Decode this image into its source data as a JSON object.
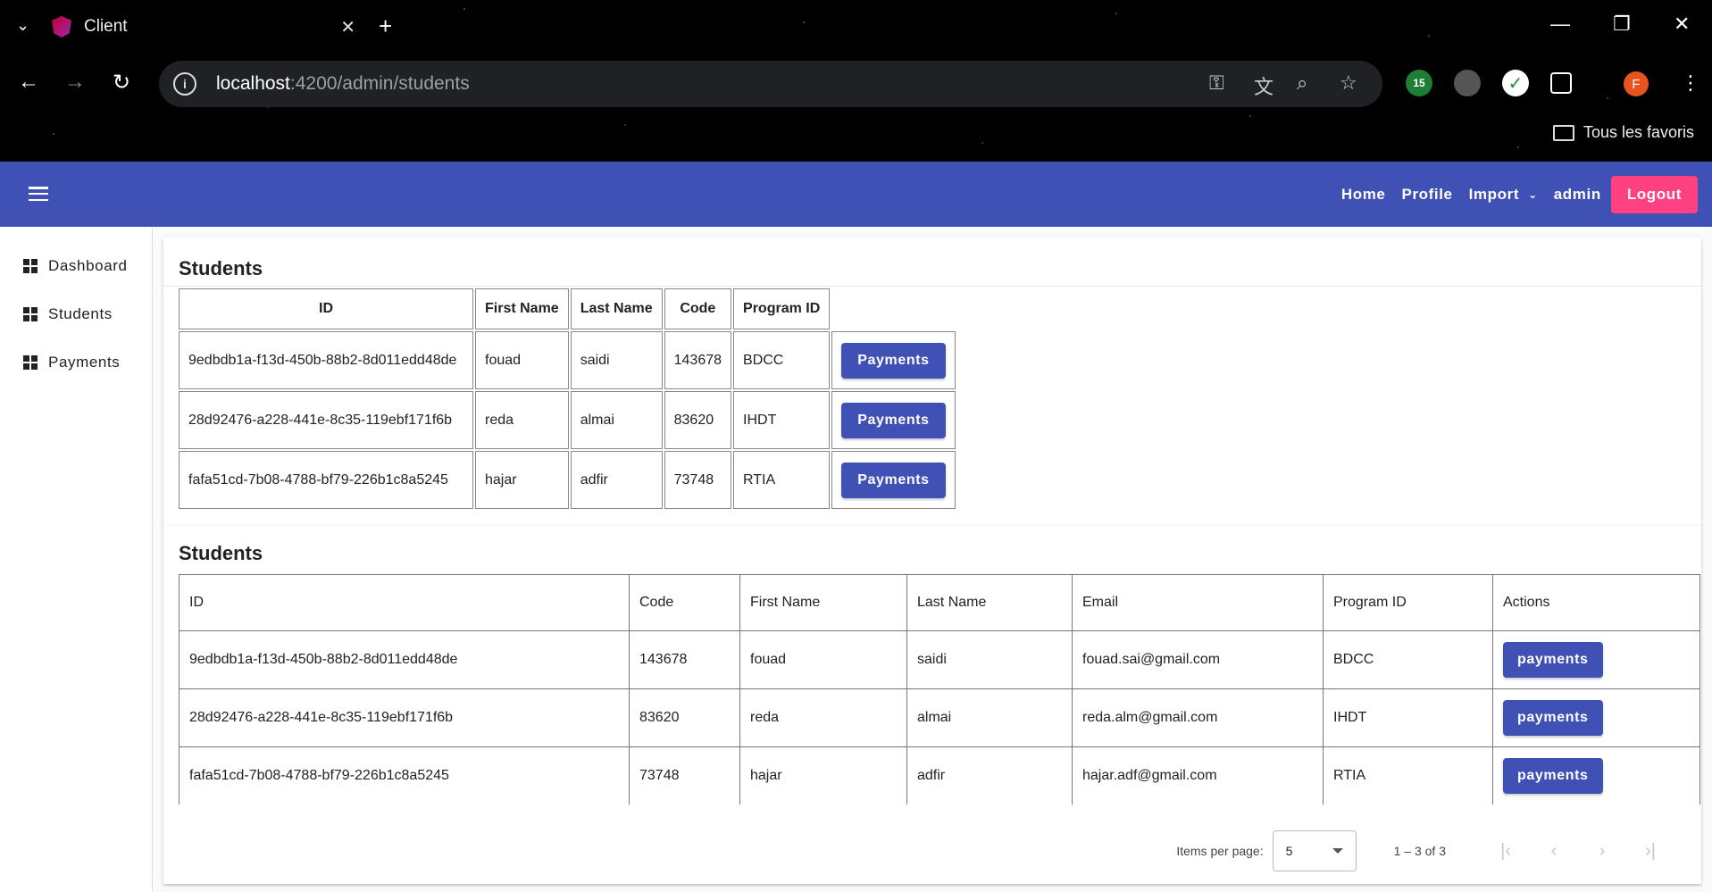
{
  "browser": {
    "tab_title": "Client",
    "url_host": "localhost",
    "url_rest": ":4200/admin/students",
    "bookmarks_label": "Tous les favoris",
    "profile_initial": "F",
    "extension_badge": "15"
  },
  "toolbar": {
    "home": "Home",
    "profile": "Profile",
    "import": "Import",
    "user": "admin",
    "logout": "Logout"
  },
  "sidebar": {
    "items": [
      {
        "label": "Dashboard"
      },
      {
        "label": "Students"
      },
      {
        "label": "Payments"
      }
    ]
  },
  "card1": {
    "title": "Students",
    "headers": [
      "ID",
      "First Name",
      "Last Name",
      "Code",
      "Program ID"
    ],
    "rows": [
      {
        "id": "9edbdb1a-f13d-450b-88b2-8d011edd48de",
        "first": "fouad",
        "last": "saidi",
        "code": "143678",
        "program": "BDCC",
        "action": "Payments"
      },
      {
        "id": "28d92476-a228-441e-8c35-119ebf171f6b",
        "first": "reda",
        "last": "almai",
        "code": "83620",
        "program": "IHDT",
        "action": "Payments"
      },
      {
        "id": "fafa51cd-7b08-4788-bf79-226b1c8a5245",
        "first": "hajar",
        "last": "adfir",
        "code": "73748",
        "program": "RTIA",
        "action": "Payments"
      }
    ]
  },
  "card2": {
    "title": "Students",
    "headers": [
      "ID",
      "Code",
      "First Name",
      "Last Name",
      "Email",
      "Program ID",
      "Actions"
    ],
    "rows": [
      {
        "id": "9edbdb1a-f13d-450b-88b2-8d011edd48de",
        "code": "143678",
        "first": "fouad",
        "last": "saidi",
        "email": "fouad.sai@gmail.com",
        "program": "BDCC",
        "action": "payments"
      },
      {
        "id": "28d92476-a228-441e-8c35-119ebf171f6b",
        "code": "83620",
        "first": "reda",
        "last": "almai",
        "email": "reda.alm@gmail.com",
        "program": "IHDT",
        "action": "payments"
      },
      {
        "id": "fafa51cd-7b08-4788-bf79-226b1c8a5245",
        "code": "73748",
        "first": "hajar",
        "last": "adfir",
        "email": "hajar.adf@gmail.com",
        "program": "RTIA",
        "action": "payments"
      }
    ],
    "paginator": {
      "items_per_page_label": "Items per page:",
      "items_per_page": "5",
      "range": "1 – 3 of 3"
    }
  },
  "colors": {
    "primary": "#3f51b5",
    "accent": "#ff4081"
  }
}
